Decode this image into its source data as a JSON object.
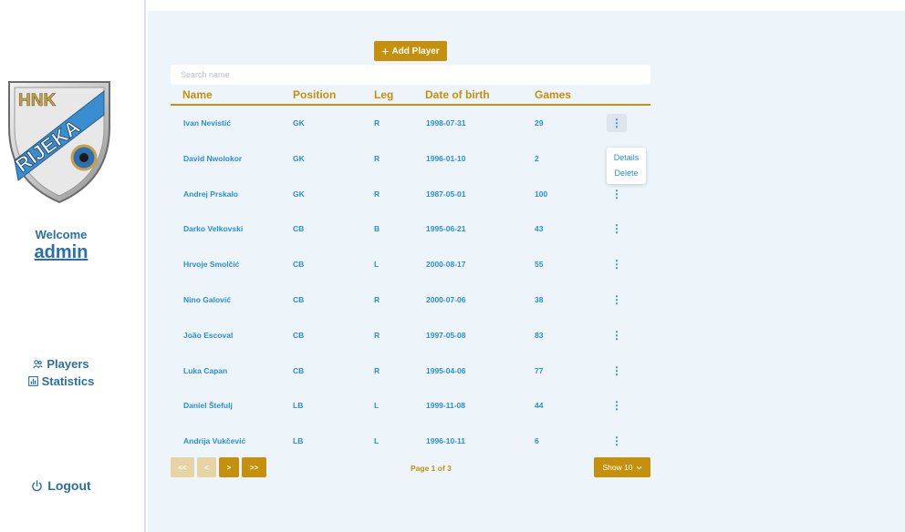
{
  "sidebar": {
    "welcome": "Welcome",
    "username": "admin",
    "nav": [
      {
        "label": "Players",
        "icon": "users-icon"
      },
      {
        "label": "Statistics",
        "icon": "chart-icon"
      }
    ],
    "logout": "Logout"
  },
  "logo": {
    "text_top": "HNK",
    "text_main": "RIJEKA"
  },
  "toolbar": {
    "add_label": "Add Player"
  },
  "search": {
    "placeholder": "Search name",
    "value": ""
  },
  "table": {
    "headers": [
      "Name",
      "Position",
      "Leg",
      "Date of birth",
      "Games"
    ],
    "rows": [
      {
        "name": "Ivan Nevistić",
        "position": "GK",
        "leg": "R",
        "dob": "1998-07-31",
        "games": "29"
      },
      {
        "name": "David Nwolokor",
        "position": "GK",
        "leg": "R",
        "dob": "1996-01-10",
        "games": "2"
      },
      {
        "name": "Andrej Prskalo",
        "position": "GK",
        "leg": "R",
        "dob": "1987-05-01",
        "games": "100"
      },
      {
        "name": "Darko Velkovski",
        "position": "CB",
        "leg": "B",
        "dob": "1995-06-21",
        "games": "43"
      },
      {
        "name": "Hrvoje Smolčić",
        "position": "CB",
        "leg": "L",
        "dob": "2000-08-17",
        "games": "55"
      },
      {
        "name": "Nino Galović",
        "position": "CB",
        "leg": "R",
        "dob": "2000-07-06",
        "games": "38"
      },
      {
        "name": "João Escoval",
        "position": "CB",
        "leg": "R",
        "dob": "1997-05-08",
        "games": "83"
      },
      {
        "name": "Luka Capan",
        "position": "CB",
        "leg": "R",
        "dob": "1995-04-06",
        "games": "77"
      },
      {
        "name": "Daniel Štefulj",
        "position": "LB",
        "leg": "L",
        "dob": "1999-11-08",
        "games": "44"
      },
      {
        "name": "Andrija Vukčević",
        "position": "LB",
        "leg": "L",
        "dob": "1996-10-11",
        "games": "6"
      }
    ]
  },
  "row_menu": {
    "items": [
      "Details",
      "Delete"
    ]
  },
  "pagination": {
    "first": "<<",
    "prev": "<",
    "next": ">",
    "last": ">>",
    "info": "Page 1 of 3",
    "show": "Show 10"
  },
  "colors": {
    "accent": "#c5900d",
    "link": "#2a8fd6",
    "nav": "#2a6fa8",
    "background": "#edf4fa"
  }
}
